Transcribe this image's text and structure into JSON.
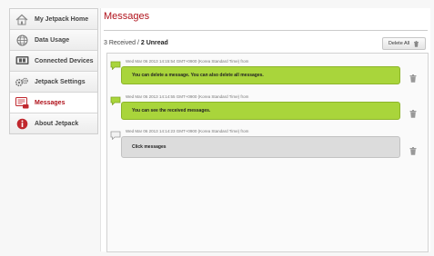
{
  "sidebar": {
    "items": [
      {
        "label": "My Jetpack Home",
        "icon": "home-icon"
      },
      {
        "label": "Data Usage",
        "icon": "globe-icon"
      },
      {
        "label": "Connected Devices",
        "icon": "devices-icon"
      },
      {
        "label": "Jetpack Settings",
        "icon": "gears-icon"
      },
      {
        "label": "Messages",
        "icon": "messages-icon",
        "active": true
      },
      {
        "label": "About Jetpack",
        "icon": "info-icon"
      }
    ]
  },
  "main": {
    "title": "Messages",
    "received_label": "3 Received",
    "separator": " / ",
    "unread_label": "2 Unread",
    "delete_all_label": "Delete All"
  },
  "messages": [
    {
      "meta": "Wed Mar 06 2013 14:15:54 GMT+0900 (Korea Standard Time) from",
      "text": "You can delete a message. You can also delete all messages.",
      "unread": true
    },
    {
      "meta": "Wed Mar 06 2013 14:14:55 GMT+0900 (Korea Standard Time) from",
      "text": "You can see the received messages.",
      "unread": true
    },
    {
      "meta": "Wed Mar 06 2013 14:14:23 GMT+0900 (Korea Standard Time) from",
      "text": "Click messages",
      "unread": false
    }
  ],
  "colors": {
    "accent": "#b0121b",
    "unread_bubble": "#a9d53b",
    "read_bubble": "#dcdcdc"
  }
}
